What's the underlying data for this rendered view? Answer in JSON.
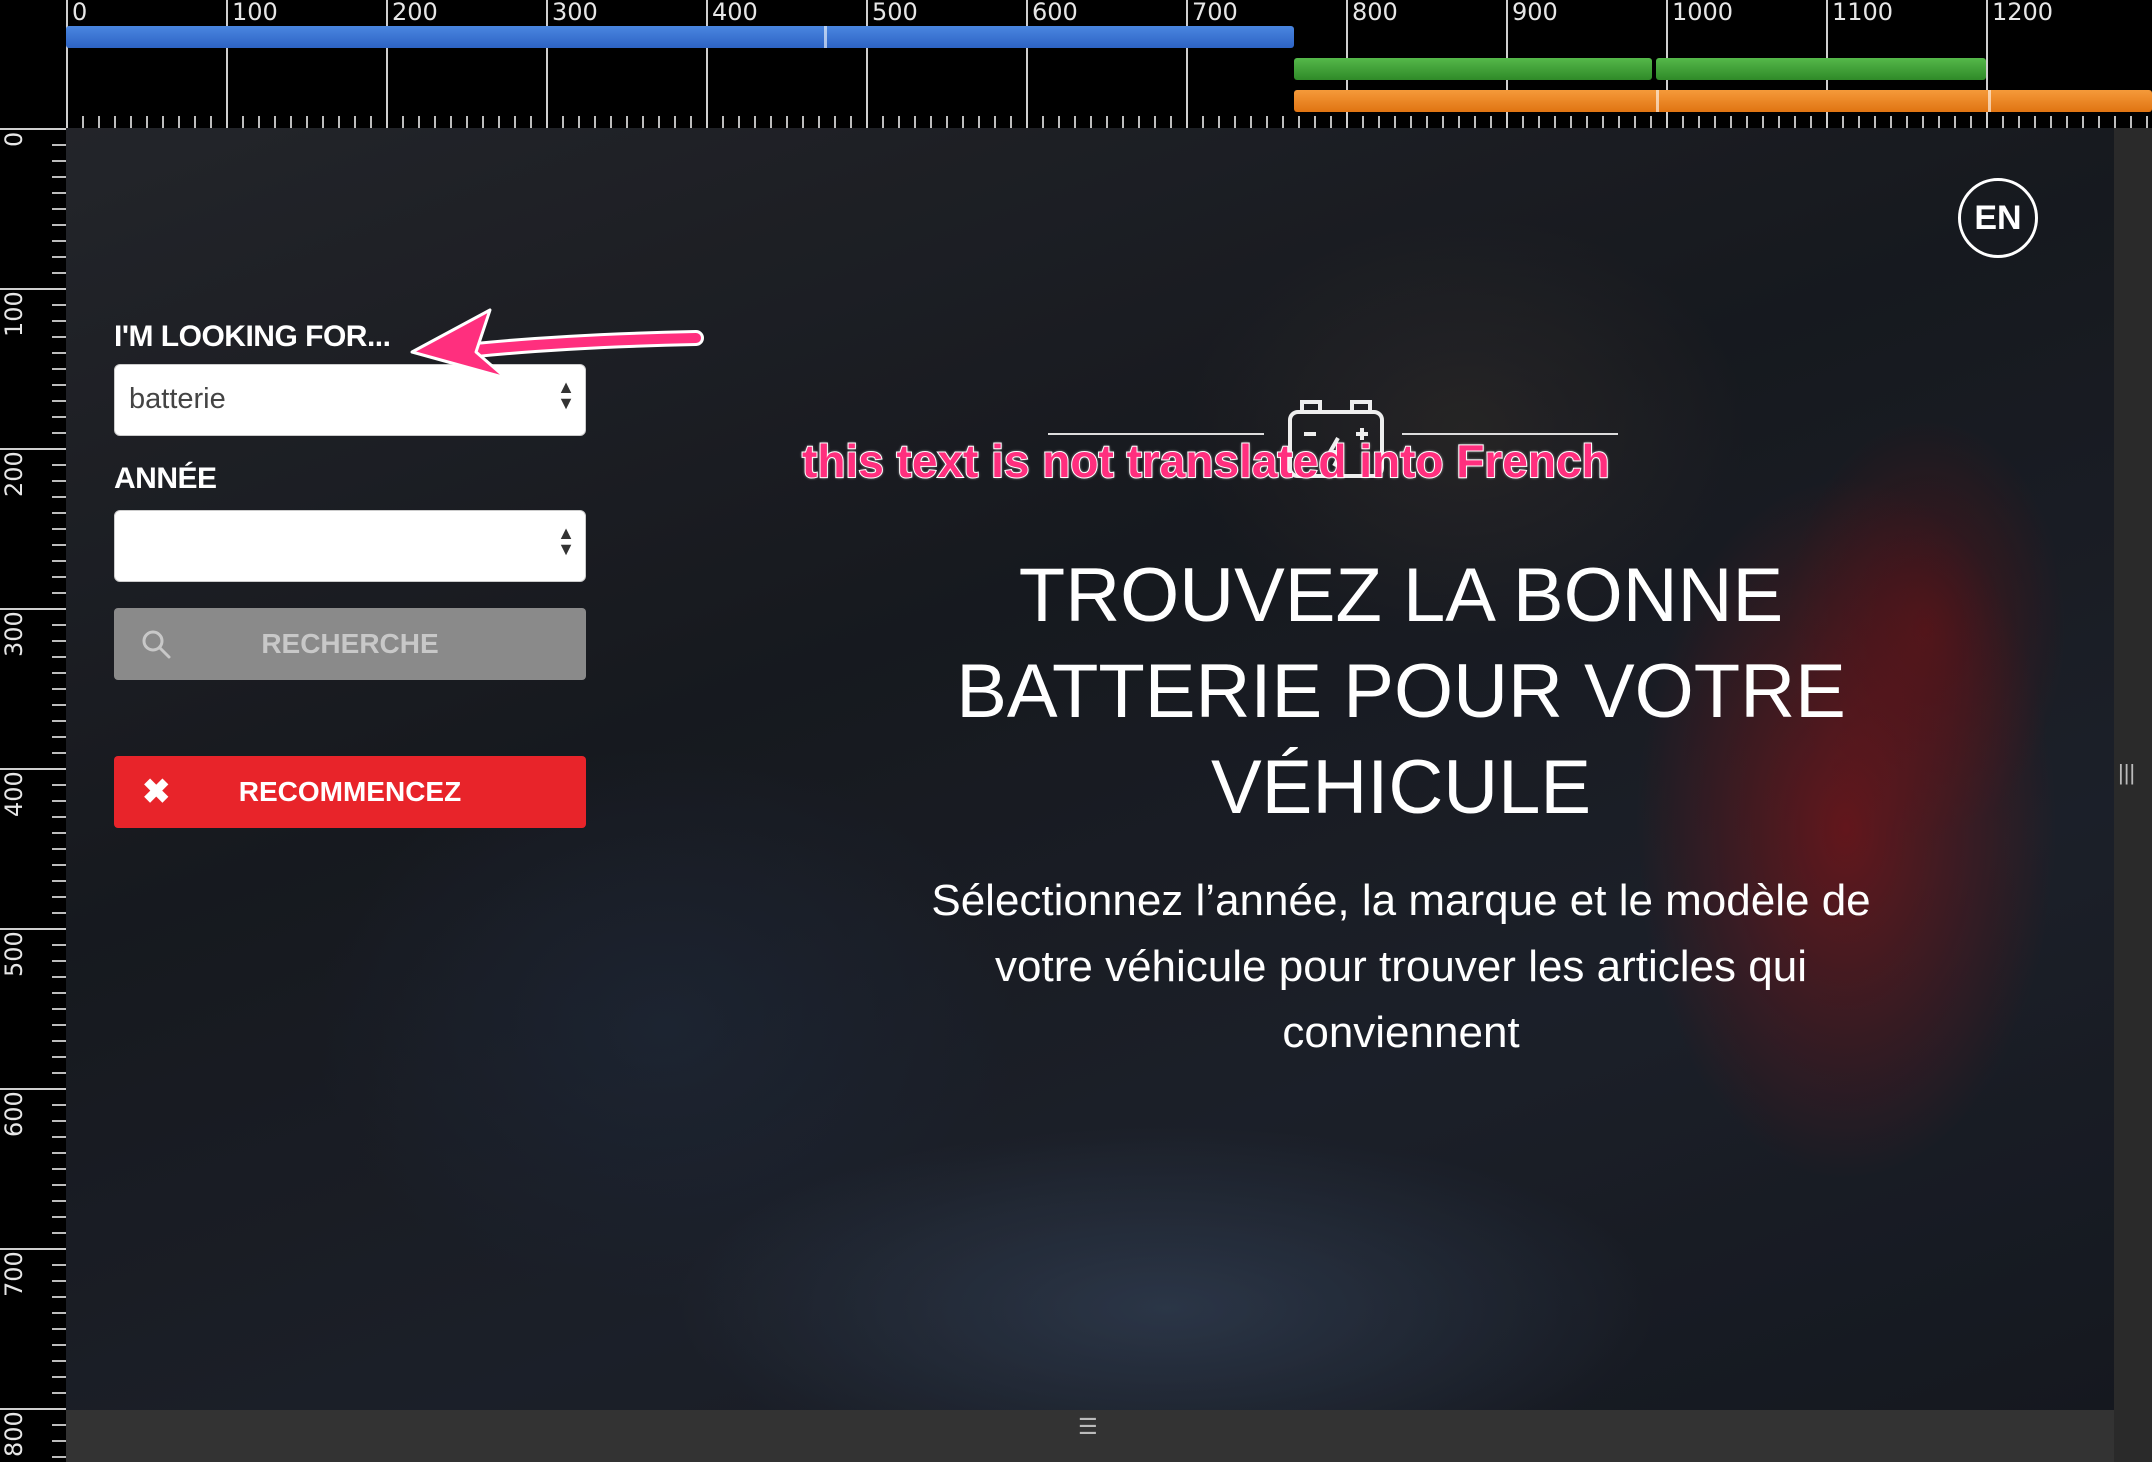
{
  "ruler": {
    "top_labels": [
      "0",
      "100",
      "200",
      "300",
      "400",
      "500",
      "600",
      "700",
      "800",
      "900",
      "1000",
      "1100",
      "1200"
    ],
    "left_labels": [
      "0",
      "100",
      "200",
      "300",
      "400",
      "500",
      "600",
      "700",
      "800"
    ]
  },
  "colors": {
    "accent_red": "#e8242a",
    "annotation_pink": "#ff2f7e",
    "breakpoint_blue": "#2d63c4",
    "breakpoint_green": "#2f8a28",
    "breakpoint_orange": "#e07412"
  },
  "form": {
    "looking_for_label": "I'M LOOKING FOR...",
    "looking_for_value": "batterie",
    "year_label": "ANNÉE",
    "year_value": "",
    "search_label": "RECHERCHE",
    "reset_label": "RECOMMENCEZ"
  },
  "header": {
    "lang_toggle": "EN"
  },
  "hero": {
    "title_lines": [
      "TROUVEZ LA BONNE",
      "BATTERIE POUR VOTRE",
      "VÉHICULE"
    ],
    "subtitle_lines": [
      "Sélectionnez l’année, la marque et le modèle de",
      "votre véhicule pour trouver les articles qui",
      "conviennent"
    ]
  },
  "annotation": {
    "text": "this text is not translated into French"
  },
  "icons": {
    "search": "search-icon",
    "reset": "close-icon",
    "battery": "battery-icon",
    "select_arrows": "up-down-arrows-icon"
  }
}
